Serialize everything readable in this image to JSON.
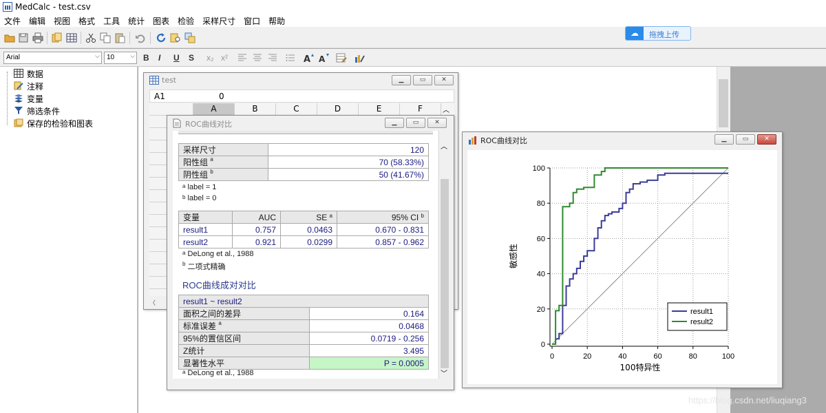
{
  "app": {
    "title": "MedCalc - test.csv"
  },
  "menu": [
    "文件",
    "编辑",
    "视图",
    "格式",
    "工具",
    "统计",
    "图表",
    "检验",
    "采样尺寸",
    "窗口",
    "帮助"
  ],
  "toolbar": {
    "icons": [
      "open-icon",
      "save-icon",
      "print-icon",
      "copy-doc-icon",
      "spreadsheet-icon",
      "cut-icon",
      "copy-icon",
      "paste-icon",
      "undo-icon",
      "refresh-icon",
      "find-icon",
      "replace-icon"
    ],
    "upload_label": "拖拽上传"
  },
  "format_bar": {
    "font": "Arial",
    "size": "10",
    "buttons": [
      "B",
      "I",
      "U",
      "S",
      "x₂",
      "x²"
    ]
  },
  "tree": {
    "items": [
      {
        "label": "数据",
        "icon": "table-icon"
      },
      {
        "label": "注释",
        "icon": "notes-icon"
      },
      {
        "label": "变量",
        "icon": "variables-icon"
      },
      {
        "label": "筛选条件",
        "icon": "filter-icon"
      },
      {
        "label": "保存的检验和图表",
        "icon": "saved-tests-icon"
      }
    ]
  },
  "spreadsheet": {
    "title": "test",
    "cell_ref": "A1",
    "cell_value": "0",
    "columns": [
      "A",
      "B",
      "C",
      "D",
      "E",
      "F"
    ]
  },
  "report": {
    "title": "ROC曲线对比",
    "sample": {
      "rows": [
        {
          "label": "采样尺寸",
          "sup": "",
          "value": "120"
        },
        {
          "label": "阳性组",
          "sup": "a",
          "value": "70 (58.33%)"
        },
        {
          "label": "阴性组",
          "sup": "b",
          "value": "50 (41.67%)"
        }
      ],
      "notes": [
        {
          "sup": "a",
          "text": "label = 1"
        },
        {
          "sup": "b",
          "text": "label = 0"
        }
      ]
    },
    "auc": {
      "headers": [
        {
          "text": "变量",
          "sup": ""
        },
        {
          "text": "AUC",
          "sup": ""
        },
        {
          "text": "SE",
          "sup": "a"
        },
        {
          "text": "95% CI",
          "sup": "b"
        }
      ],
      "rows": [
        {
          "var": "result1",
          "auc": "0.757",
          "se": "0.0463",
          "ci": "0.670 - 0.831"
        },
        {
          "var": "result2",
          "auc": "0.921",
          "se": "0.0299",
          "ci": "0.857 - 0.962"
        }
      ],
      "notes": [
        {
          "sup": "a",
          "text": "DeLong et al., 1988"
        },
        {
          "sup": "b",
          "text": "二项式精确"
        }
      ]
    },
    "pairwise": {
      "heading": "ROC曲线成对对比",
      "pair": "result1 ~ result2",
      "rows": [
        {
          "label": "面积之间的差异",
          "sup": "",
          "value": "0.164"
        },
        {
          "label": "标准误差",
          "sup": "a",
          "value": "0.0468"
        },
        {
          "label": "95%的置信区间",
          "sup": "",
          "value": "0.0719 - 0.256"
        },
        {
          "label": "Z统计",
          "sup": "",
          "value": "3.495"
        },
        {
          "label": "显著性水平",
          "sup": "",
          "value": "P = 0.0005"
        }
      ],
      "note": {
        "sup": "a",
        "text": "DeLong et al., 1988"
      },
      "highlight_color": "#c6f5c6"
    }
  },
  "graph_window": {
    "title": "ROC曲线对比"
  },
  "chart_data": {
    "type": "line",
    "xlabel": "100特异性",
    "ylabel": "敏感性",
    "xlim": [
      0,
      100
    ],
    "ylim": [
      0,
      100
    ],
    "xticks": [
      0,
      20,
      40,
      60,
      80,
      100
    ],
    "yticks": [
      0,
      20,
      40,
      60,
      80,
      100
    ],
    "grid": true,
    "legend_position": "bottom-right",
    "series": [
      {
        "name": "result1",
        "color": "#3b3b9a",
        "x": [
          0,
          2,
          2,
          4,
          4,
          6,
          6,
          8,
          8,
          10,
          10,
          12,
          12,
          14,
          14,
          16,
          16,
          18,
          18,
          20,
          20,
          24,
          24,
          26,
          26,
          28,
          28,
          30,
          30,
          32,
          32,
          34,
          34,
          38,
          38,
          40,
          40,
          42,
          42,
          44,
          44,
          46,
          46,
          50,
          50,
          54,
          54,
          60,
          60,
          64,
          64,
          100
        ],
        "y": [
          0,
          0,
          3,
          3,
          6,
          6,
          22,
          22,
          33,
          33,
          37,
          37,
          40,
          40,
          43,
          43,
          47,
          47,
          50,
          50,
          53,
          53,
          60,
          60,
          66,
          66,
          70,
          70,
          73,
          73,
          74,
          74,
          75,
          75,
          77,
          77,
          80,
          80,
          86,
          86,
          88,
          88,
          91,
          91,
          92,
          92,
          93,
          93,
          96,
          96,
          97,
          97
        ]
      },
      {
        "name": "result2",
        "color": "#2f8a2f",
        "x": [
          0,
          2,
          2,
          4,
          4,
          6,
          6,
          10,
          10,
          12,
          12,
          14,
          14,
          18,
          18,
          24,
          24,
          28,
          28,
          30,
          30,
          100
        ],
        "y": [
          0,
          0,
          19,
          19,
          22,
          22,
          78,
          78,
          80,
          80,
          86,
          86,
          88,
          88,
          89,
          89,
          96,
          96,
          98,
          98,
          100,
          100
        ]
      }
    ],
    "diagonal": true
  },
  "watermark": "https://blog.csdn.net/liuqiang3"
}
